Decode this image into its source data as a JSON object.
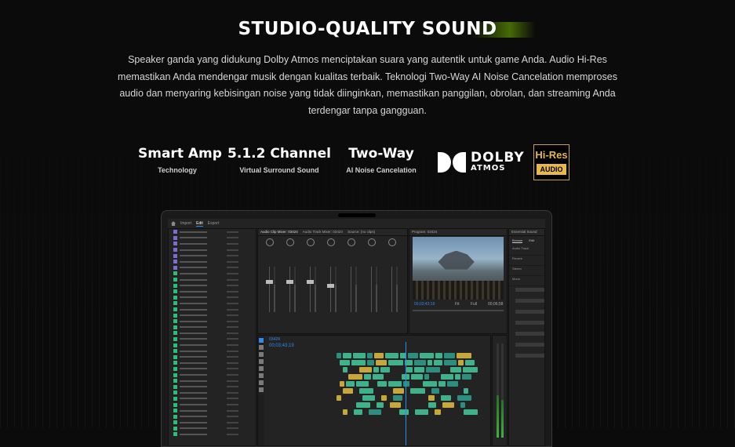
{
  "section": {
    "title": "STUDIO-QUALITY SOUND",
    "description": "Speaker ganda yang didukung Dolby Atmos menciptakan suara yang autentik untuk game Anda. Audio Hi-Res memastikan Anda mendengar musik dengan kualitas terbaik. Teknologi Two-Way AI Noise Cancelation memproses audio dan menyaring kebisingan noise yang tidak diinginkan, memastikan panggilan, obrolan, dan streaming Anda terdengar tanpa gangguan."
  },
  "features": [
    {
      "title": "Smart Amp",
      "subtitle": "Technology"
    },
    {
      "title": "5.1.2 Channel",
      "subtitle": "Virtual Surround Sound"
    },
    {
      "title": "Two-Way",
      "subtitle": "AI Noise Cancelation"
    }
  ],
  "logos": {
    "dolby_line1": "DOLBY",
    "dolby_line2": "ATMOS",
    "hires_line1": "Hi-Res",
    "hires_line2": "AUDIO"
  },
  "editor": {
    "tabs": [
      "Import",
      "Edit",
      "Export"
    ],
    "active_tab": "Edit",
    "mixer_tabs": [
      "Audio Clip Mixer: 03424",
      "Audio Track Mixer: 03424",
      "Source: (no clips)"
    ],
    "program_label": "Program: 03424",
    "timecode": "00;03;43;19",
    "timeline_timecode": "00;03;43;19",
    "zoom": "Fit",
    "quality": "Full",
    "duration": "00;06;58",
    "essential_sound_title": "Essential Sound",
    "essential_tabs": [
      "Browse",
      "Edit"
    ],
    "essential_items": [
      "Audio Track",
      "Reverb",
      "Stereo",
      "Mono"
    ],
    "sequence_label": "03424"
  },
  "colors": {
    "accent_green": "#76b900",
    "premiere_blue": "#2d8ceb",
    "clip_green": "#3fb28c",
    "clip_teal": "#2b8e7e",
    "clip_yellow": "#c8a73a"
  }
}
